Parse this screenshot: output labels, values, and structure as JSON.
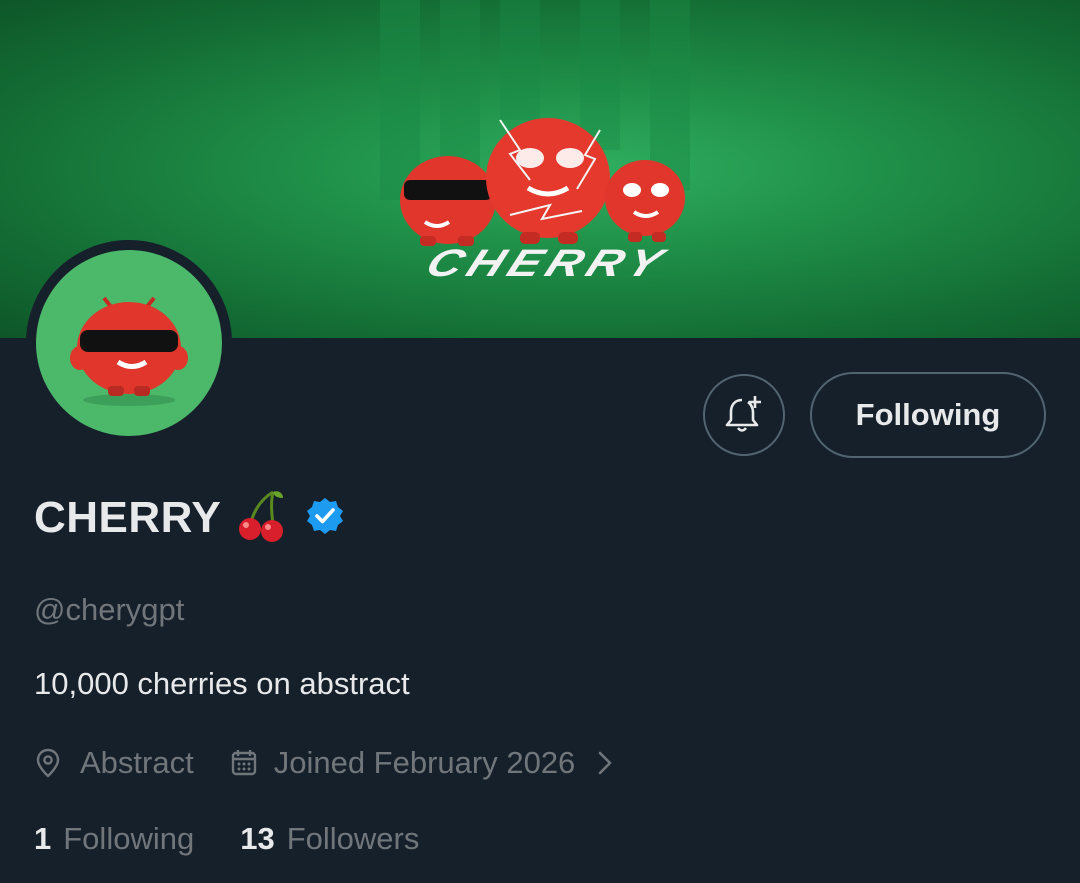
{
  "banner": {
    "wordmark": "CHERRY"
  },
  "profile": {
    "display_name": "CHERRY",
    "handle": "@cherygpt",
    "bio": "10,000 cherries on abstract",
    "location": "Abstract",
    "joined": "Joined February 2026"
  },
  "actions": {
    "following_label": "Following"
  },
  "stats": {
    "following_count": "1",
    "following_label": "Following",
    "followers_count": "13",
    "followers_label": "Followers"
  },
  "colors": {
    "background": "#16202b",
    "banner_green": "#1f8f48",
    "avatar_green": "#4cb86a",
    "verified_blue": "#1d9bf0",
    "muted_text": "#71767b",
    "cherry_red": "#e53a2e"
  },
  "icons": [
    "bell-plus-icon",
    "verified-badge-icon",
    "location-pin-icon",
    "calendar-icon",
    "chevron-right-icon",
    "cherry-emoji-icon"
  ]
}
